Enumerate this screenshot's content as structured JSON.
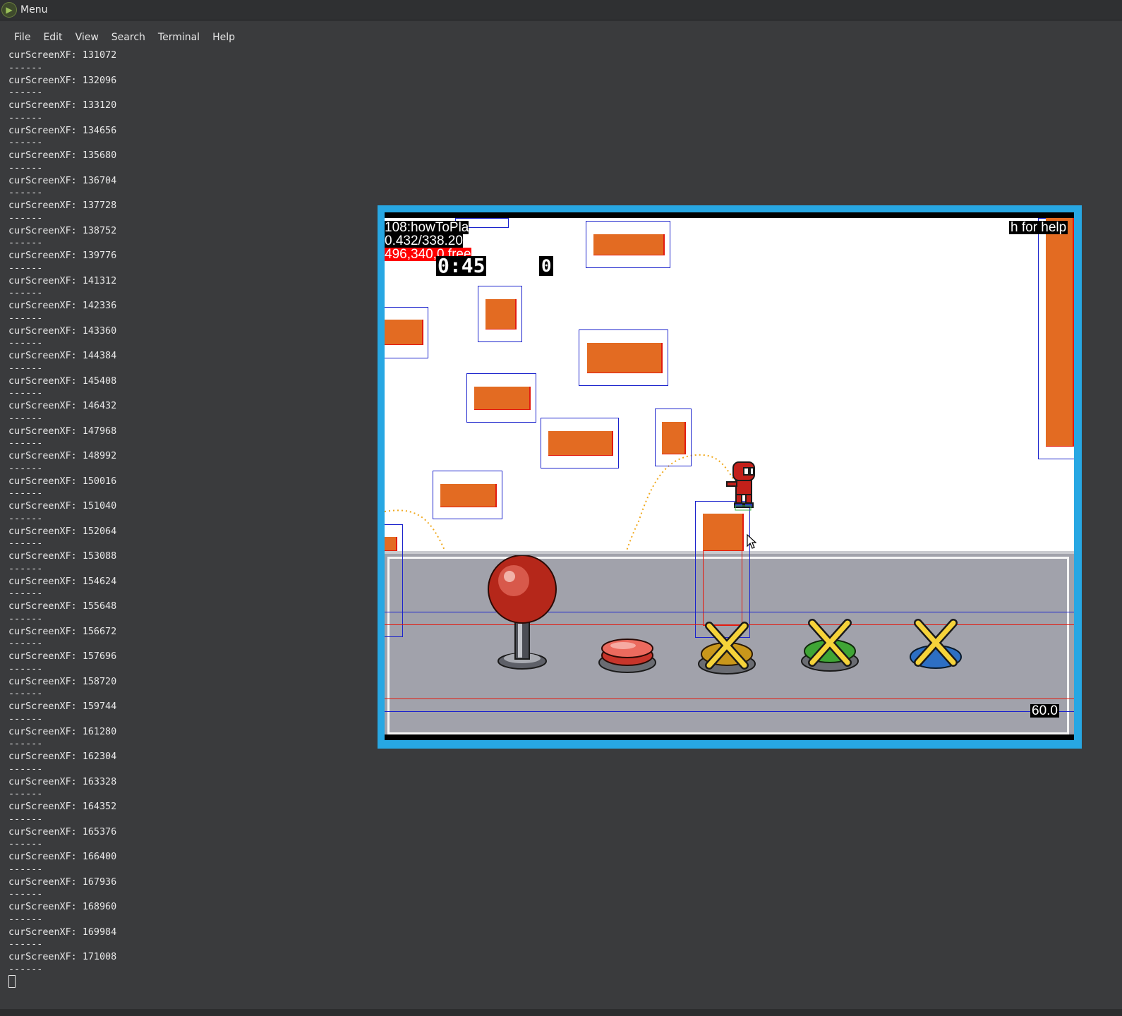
{
  "panel": {
    "menu_label": "Menu",
    "logo_icon": "mint-menu-icon"
  },
  "terminal": {
    "menu": [
      "File",
      "Edit",
      "View",
      "Search",
      "Terminal",
      "Help"
    ],
    "values": [
      "131072",
      "132096",
      "133120",
      "134656",
      "135680",
      "136704",
      "137728",
      "138752",
      "139776",
      "141312",
      "142336",
      "143360",
      "144384",
      "145408",
      "146432",
      "147968",
      "148992",
      "150016",
      "151040",
      "152064",
      "153088",
      "154624",
      "155648",
      "156672",
      "157696",
      "158720",
      "159744",
      "161280",
      "162304",
      "163328",
      "164352",
      "165376",
      "166400",
      "167936",
      "168960",
      "169984",
      "171008"
    ],
    "line_prefix": "curScreenXF: ",
    "separator": "------"
  },
  "game": {
    "hud_line1": "108:howToPla",
    "hud_line2": "0.432/338.20",
    "hud_line3": "496,340,0,free",
    "timer": "0:45",
    "counter": "0",
    "help_text": "h for help",
    "fps": "60.0",
    "colors": {
      "frame": "#27a7e3",
      "platform": "#e36b22",
      "hitbox_blue": "#1a22cc",
      "hitbox_red": "#e31a0f",
      "floor": "#a1a2ab",
      "trajectory": "#f0a81c"
    },
    "controls": [
      {
        "name": "joystick",
        "color": "#c0392b"
      },
      {
        "name": "red-button",
        "color": "#e74c3c"
      },
      {
        "name": "yellow-button-crossed",
        "color": "#d4a017"
      },
      {
        "name": "green-button-crossed",
        "color": "#3fa535"
      },
      {
        "name": "blue-button-crossed",
        "color": "#2d6fc4"
      }
    ]
  }
}
